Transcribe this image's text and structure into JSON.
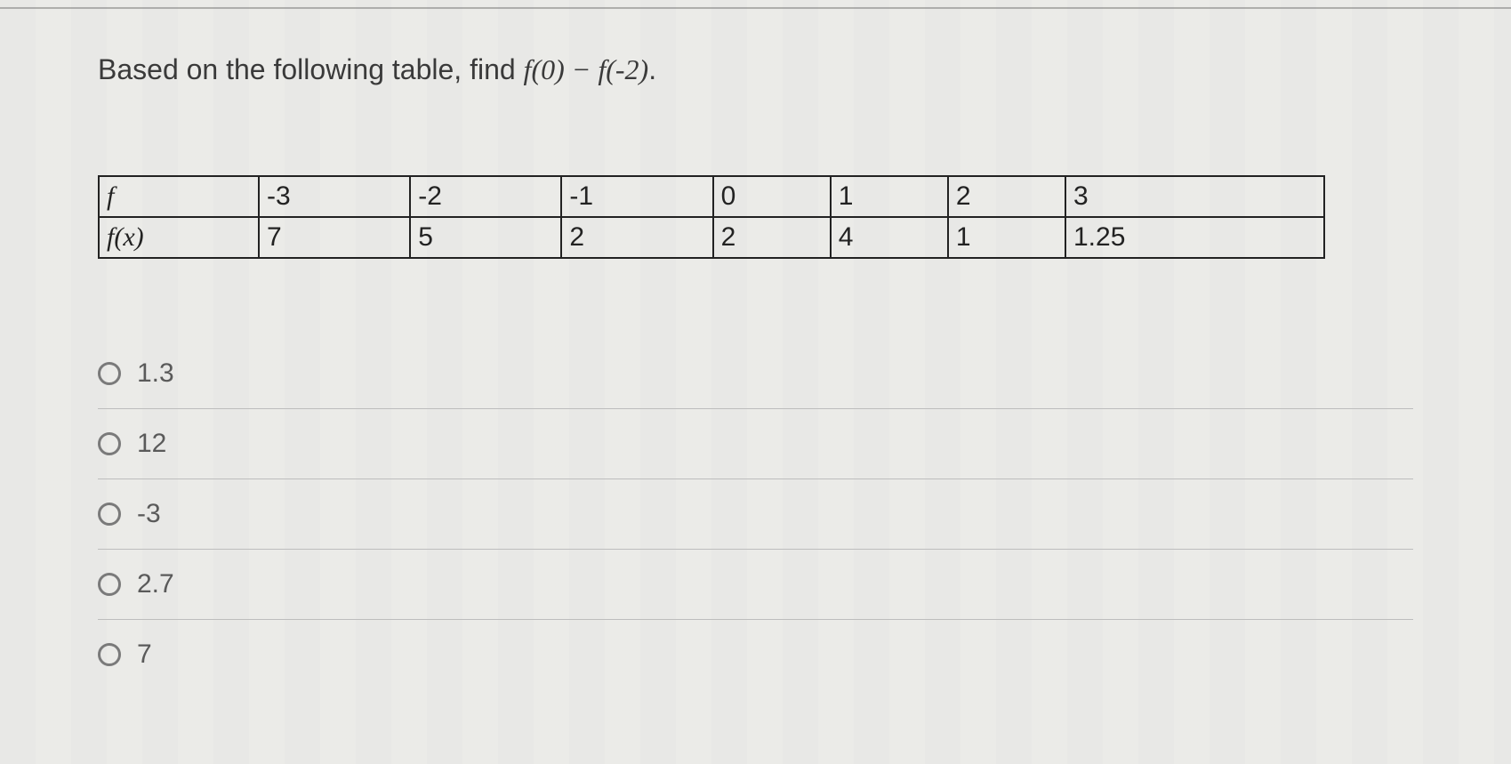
{
  "question_prefix": "Based on the following table, find ",
  "question_expression": "f(0) − f(-2)",
  "question_suffix": ".",
  "table": {
    "row1_label": "f",
    "row2_label": "f(x)",
    "row1": [
      "-3",
      "-2",
      "-1",
      "0",
      "1",
      "2",
      "3"
    ],
    "row2": [
      "7",
      "5",
      "2",
      "2",
      "4",
      "1",
      "1.25"
    ]
  },
  "options": [
    "1.3",
    "12",
    "-3",
    "2.7",
    "7"
  ],
  "chart_data": {
    "type": "table",
    "title": "Function table for f(x)",
    "x_label": "f",
    "y_label": "f(x)",
    "x": [
      -3,
      -2,
      -1,
      0,
      1,
      2,
      3
    ],
    "y": [
      7,
      5,
      2,
      2,
      4,
      1,
      1.25
    ]
  }
}
